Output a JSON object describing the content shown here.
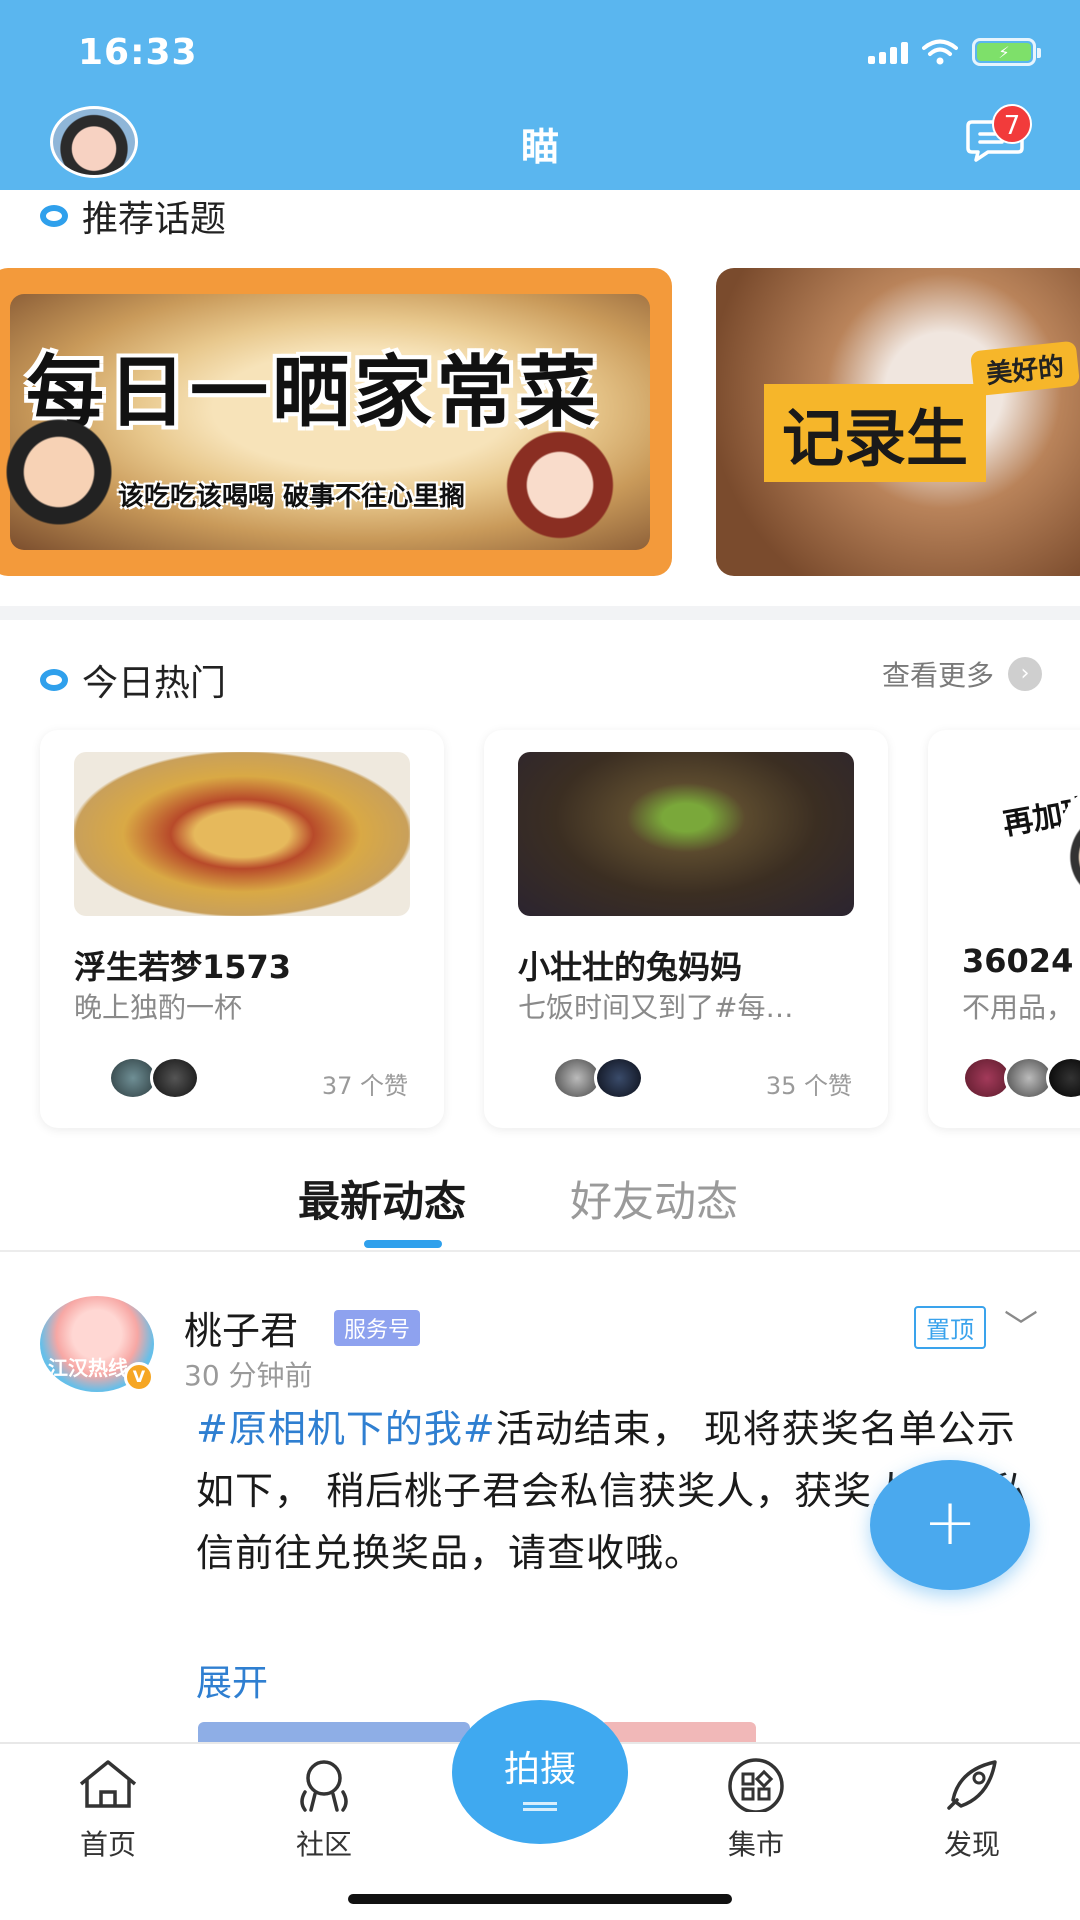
{
  "status_bar": {
    "time": "16:33"
  },
  "header": {
    "title": "瞄",
    "message_count": "7"
  },
  "recommended": {
    "title": "推荐话题",
    "banners": [
      {
        "headline": "每日一晒家常菜",
        "subline": "该吃吃该喝喝 破事不往心里搁"
      },
      {
        "tag": "美好的",
        "headline": "记录生"
      }
    ]
  },
  "hot_today": {
    "title": "今日热门",
    "see_more": "查看更多",
    "cards": [
      {
        "name": "浮生若梦1573",
        "desc": "晚上独酌一杯",
        "likes": "37 个赞"
      },
      {
        "name": "小壮壮的兔妈妈",
        "desc": "七饭时间又到了#每…",
        "likes": "35 个赞"
      },
      {
        "name": "36024",
        "desc": "不用品，",
        "overlay_text": "再加班"
      }
    ]
  },
  "tabs": {
    "active": "最新动态",
    "inactive": "好友动态"
  },
  "post": {
    "author": "桃子君",
    "badge": "服务号",
    "avatar_text": "江汉热线",
    "time": "30 分钟前",
    "pinned": "置顶",
    "topic": "#原相机下的我#",
    "body": "活动结束， 现将获奖名单公示如下， 稍后桃子君会私信获奖人，获奖人凭借私信前往兑换奖品，请查收哦。",
    "expand": "展开"
  },
  "fab": {
    "icon": "plus-icon"
  },
  "bottom_nav": {
    "home": "首页",
    "community": "社区",
    "shoot": "拍摄",
    "market": "集市",
    "discover": "发现"
  },
  "colors": {
    "header_blue": "#5ab6ef",
    "accent": "#2fa0ec",
    "link": "#2f7fd1",
    "badge_red": "#f23b3b"
  }
}
